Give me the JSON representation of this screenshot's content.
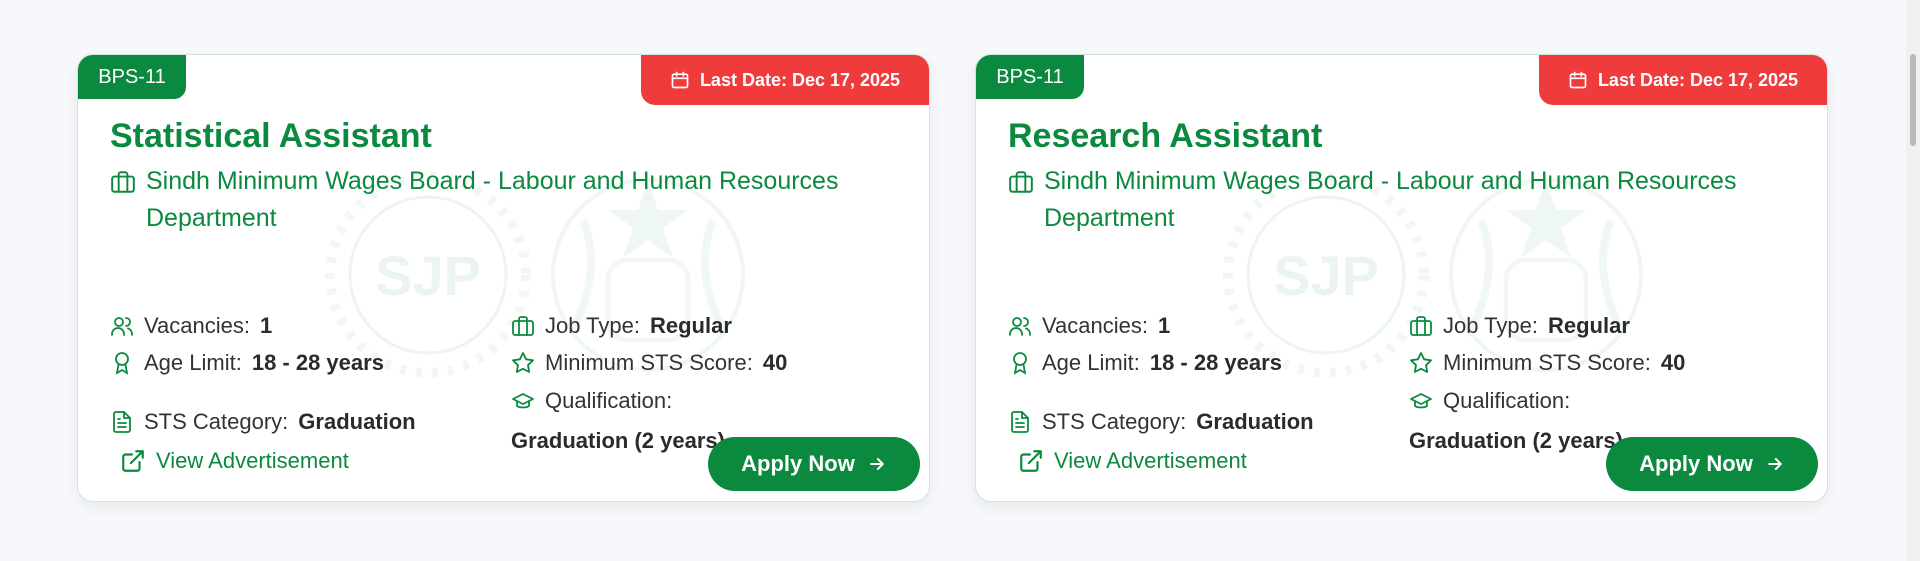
{
  "colors": {
    "accent": "#0b8a3f",
    "danger": "#ef3b3b",
    "text": "#333333"
  },
  "watermark": {
    "text": "SJP"
  },
  "labels": {
    "vacancies": "Vacancies:",
    "age_limit": "Age Limit:",
    "sts_category": "STS Category:",
    "job_type": "Job Type:",
    "min_sts": "Minimum STS Score:",
    "qualification": "Qualification:",
    "view_adv": "View Advertisement",
    "apply": "Apply Now"
  },
  "jobs": [
    {
      "bps": "BPS-11",
      "last_date": "Last Date: Dec 17, 2025",
      "title": "Statistical Assistant",
      "department": "Sindh Minimum Wages Board - Labour and Human Resources Department",
      "vacancies": "1",
      "age_limit": "18 - 28 years",
      "sts_category": "Graduation",
      "job_type": "Regular",
      "min_sts": "40",
      "qualification": "Graduation (2 years)"
    },
    {
      "bps": "BPS-11",
      "last_date": "Last Date: Dec 17, 2025",
      "title": "Research Assistant",
      "department": "Sindh Minimum Wages Board - Labour and Human Resources Department",
      "vacancies": "1",
      "age_limit": "18 - 28 years",
      "sts_category": "Graduation",
      "job_type": "Regular",
      "min_sts": "40",
      "qualification": "Graduation (2 years)"
    }
  ]
}
